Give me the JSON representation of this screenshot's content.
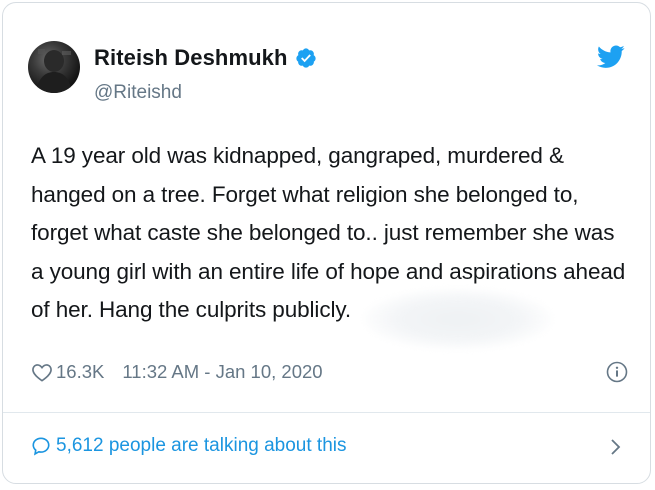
{
  "tweet": {
    "author": {
      "display_name": "Riteish Deshmukh",
      "handle": "@Riteishd",
      "verified": true
    },
    "text": "A 19 year old was kidnapped, gangraped, murdered & hanged on a tree. Forget what religion she belonged to, forget what caste she belonged to.. just remember she was a young girl with an entire life of hope and aspirations ahead of her. Hang the culprits publicly.",
    "likes": "16.3K",
    "timestamp": "11:32 AM - Jan 10, 2020",
    "talking_about": "5,612 people are talking about this"
  },
  "icons": {
    "brand": "twitter-bird-icon",
    "verified": "verified-badge-icon",
    "like": "heart-icon",
    "info": "info-icon",
    "comment": "speech-bubble-icon",
    "chevron": "chevron-right-icon"
  },
  "colors": {
    "brand_blue": "#1da1f2",
    "link_blue": "#1b95e0",
    "text": "#14171a",
    "muted": "#657786"
  }
}
